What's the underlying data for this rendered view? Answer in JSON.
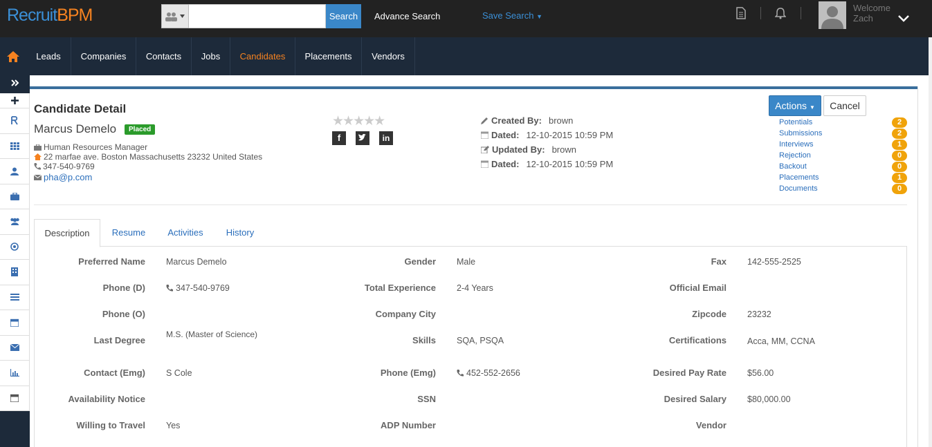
{
  "app": {
    "logo_part1": "Recruit",
    "logo_part2": "BPM"
  },
  "topbar": {
    "search_placeholder": "",
    "search_label": "Search",
    "advance_search": "Advance Search",
    "save_search": "Save Search",
    "welcome": "Welcome",
    "user": "Zach"
  },
  "nav": {
    "items": [
      "Leads",
      "Companies",
      "Contacts",
      "Jobs",
      "Candidates",
      "Placements",
      "Vendors"
    ],
    "active": "Candidates"
  },
  "header": {
    "title": "Candidate Detail",
    "candidate_name": "Marcus Demelo",
    "status": "Placed",
    "job_title": "Human Resources Manager",
    "address": "22 marfae ave. Boston Massachusetts 23232 United States",
    "phone": "347-540-9769",
    "email": "pha@p.com"
  },
  "meta": {
    "created_by_label": "Created By:",
    "created_by": "brown",
    "dated_label": "Dated:",
    "created_date": "12-10-2015 10:59 PM",
    "updated_by_label": "Updated By:",
    "updated_by": "brown",
    "updated_date": "12-10-2015 10:59 PM"
  },
  "actions": {
    "actions_label": "Actions",
    "cancel_label": "Cancel"
  },
  "counts": [
    {
      "label": "Potentials",
      "count": "2"
    },
    {
      "label": "Submissions",
      "count": "2"
    },
    {
      "label": "Interviews",
      "count": "1"
    },
    {
      "label": "Rejection",
      "count": "0"
    },
    {
      "label": "Backout",
      "count": "0"
    },
    {
      "label": "Placements",
      "count": "1"
    },
    {
      "label": "Documents",
      "count": "0"
    }
  ],
  "tabs": [
    "Description",
    "Resume",
    "Activities",
    "History"
  ],
  "details": {
    "col1": [
      {
        "label": "Preferred Name",
        "value": "Marcus Demelo"
      },
      {
        "label": "Phone (D)",
        "value": "347-540-9769"
      },
      {
        "label": "Phone (O)",
        "value": ""
      },
      {
        "label": "Last Degree",
        "value": "M.S. (Master of Science)"
      },
      {
        "label": "Contact (Emg)",
        "value": "S Cole"
      },
      {
        "label": "Availability Notice",
        "value": ""
      },
      {
        "label": "Willing to Travel",
        "value": "Yes"
      }
    ],
    "col2": [
      {
        "label": "Gender",
        "value": "Male"
      },
      {
        "label": "Total Experience",
        "value": "2-4 Years"
      },
      {
        "label": "Company City",
        "value": ""
      },
      {
        "label": "Skills",
        "value": "SQA, PSQA"
      },
      {
        "label": "Phone (Emg)",
        "value": "452-552-2656"
      },
      {
        "label": "SSN",
        "value": ""
      },
      {
        "label": "ADP Number",
        "value": ""
      }
    ],
    "col3": [
      {
        "label": "Fax",
        "value": "142-555-2525"
      },
      {
        "label": "Official Email",
        "value": ""
      },
      {
        "label": "Zipcode",
        "value": "23232"
      },
      {
        "label": "Certifications",
        "value": "Acca, MM, CCNA"
      },
      {
        "label": "Desired Pay Rate",
        "value": "$56.00"
      },
      {
        "label": "Desired Salary",
        "value": "$80,000.00"
      },
      {
        "label": "Vendor",
        "value": ""
      }
    ]
  },
  "colors": {
    "accent": "#3a87c8",
    "orange": "#f58220",
    "nav_bg": "#1d2a3a",
    "badge": "#f0a30a",
    "placed": "#2b9b2b"
  }
}
